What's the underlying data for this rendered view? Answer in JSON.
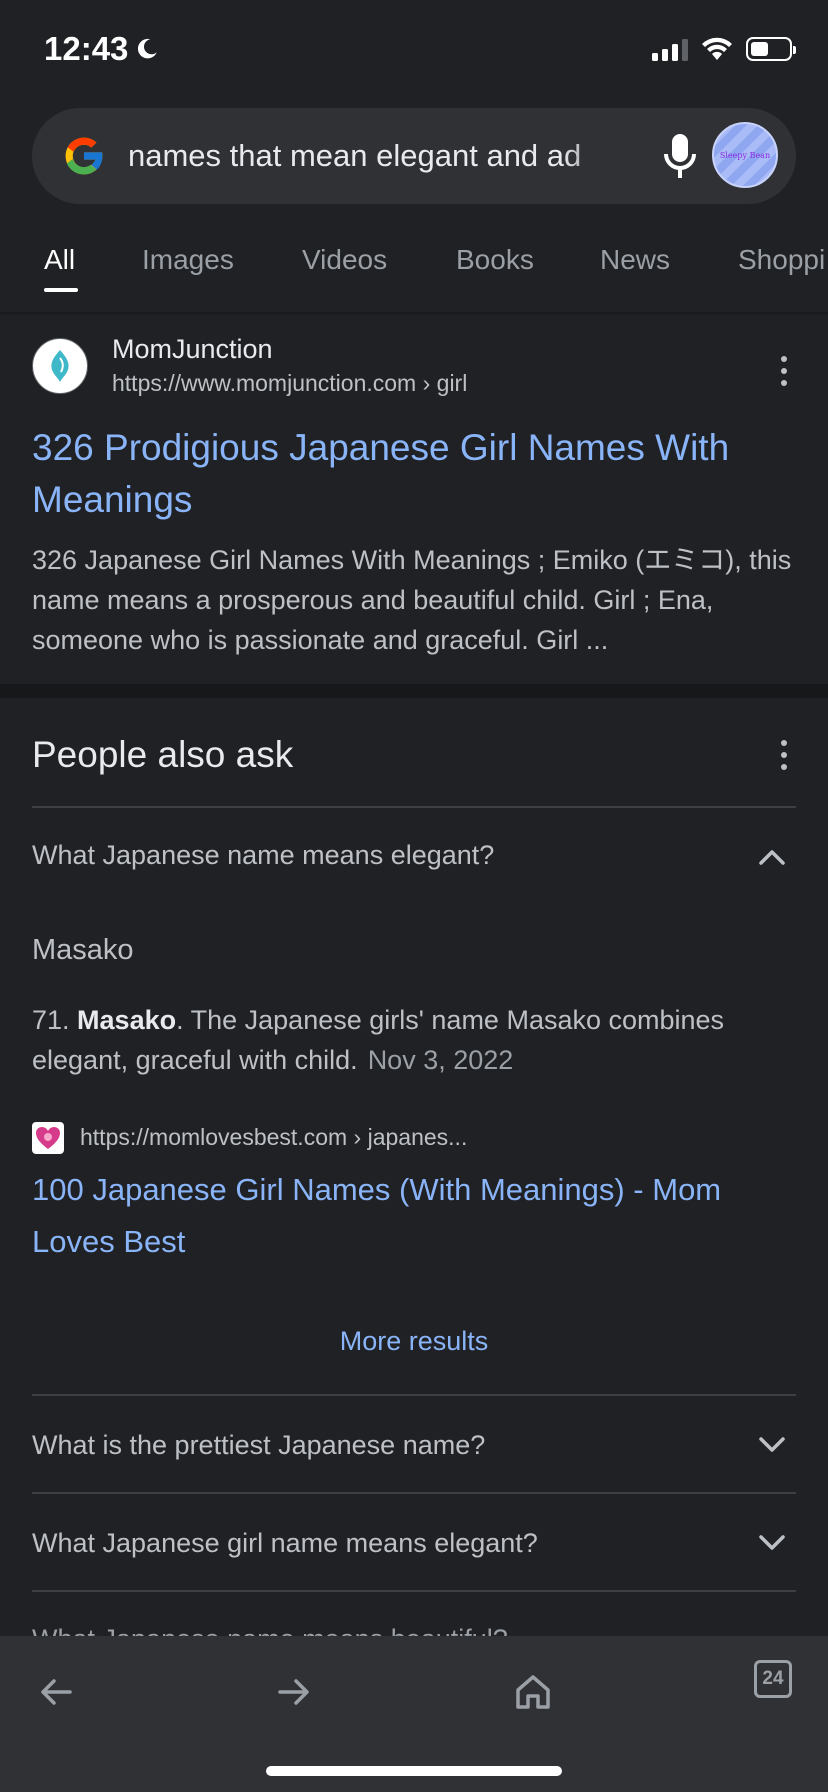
{
  "status_bar": {
    "time": "12:43"
  },
  "search": {
    "query": "names that mean elegant and ad",
    "avatar_text": "Sleepy Bean"
  },
  "tabs": [
    {
      "label": "All",
      "active": true
    },
    {
      "label": "Images"
    },
    {
      "label": "Videos"
    },
    {
      "label": "Books"
    },
    {
      "label": "News"
    },
    {
      "label": "Shoppi"
    }
  ],
  "result1": {
    "site_name": "MomJunction",
    "url": "https://www.momjunction.com › girl",
    "title": "326 Prodigious Japanese Girl Names With Meanings",
    "snippet": "326 Japanese Girl Names With Meanings ; Emiko (エミコ), this name means a prosperous and beautiful child. Girl ; Ena, someone who is passionate and graceful. Girl ..."
  },
  "paa": {
    "header": "People also ask",
    "expanded": {
      "question": "What Japanese name means elegant?",
      "answer_title": "Masako",
      "answer_prefix": "71. ",
      "answer_bold": "Masako",
      "answer_rest": ". The Japanese girls' name Masako combines elegant, graceful with child.",
      "answer_date": "Nov 3, 2022",
      "source_url": "https://momlovesbest.com › japanes...",
      "source_title": "100 Japanese Girl Names (With Meanings) - Mom Loves Best",
      "more_results": "More results"
    },
    "questions": [
      "What is the prettiest Japanese name?",
      "What Japanese girl name means elegant?",
      "What Japanese name means beautiful?"
    ]
  },
  "toolbar": {
    "tab_count": "24"
  },
  "colors": {
    "background": "#202124",
    "link": "#8ab4f8",
    "surface": "#303134"
  },
  "icons": [
    "moon-icon",
    "signal-icon",
    "wifi-icon",
    "battery-icon",
    "google-logo",
    "mic-icon",
    "kebab-icon",
    "chevron-up-icon",
    "chevron-down-icon",
    "back-icon",
    "forward-icon",
    "home-icon",
    "tabs-icon"
  ]
}
